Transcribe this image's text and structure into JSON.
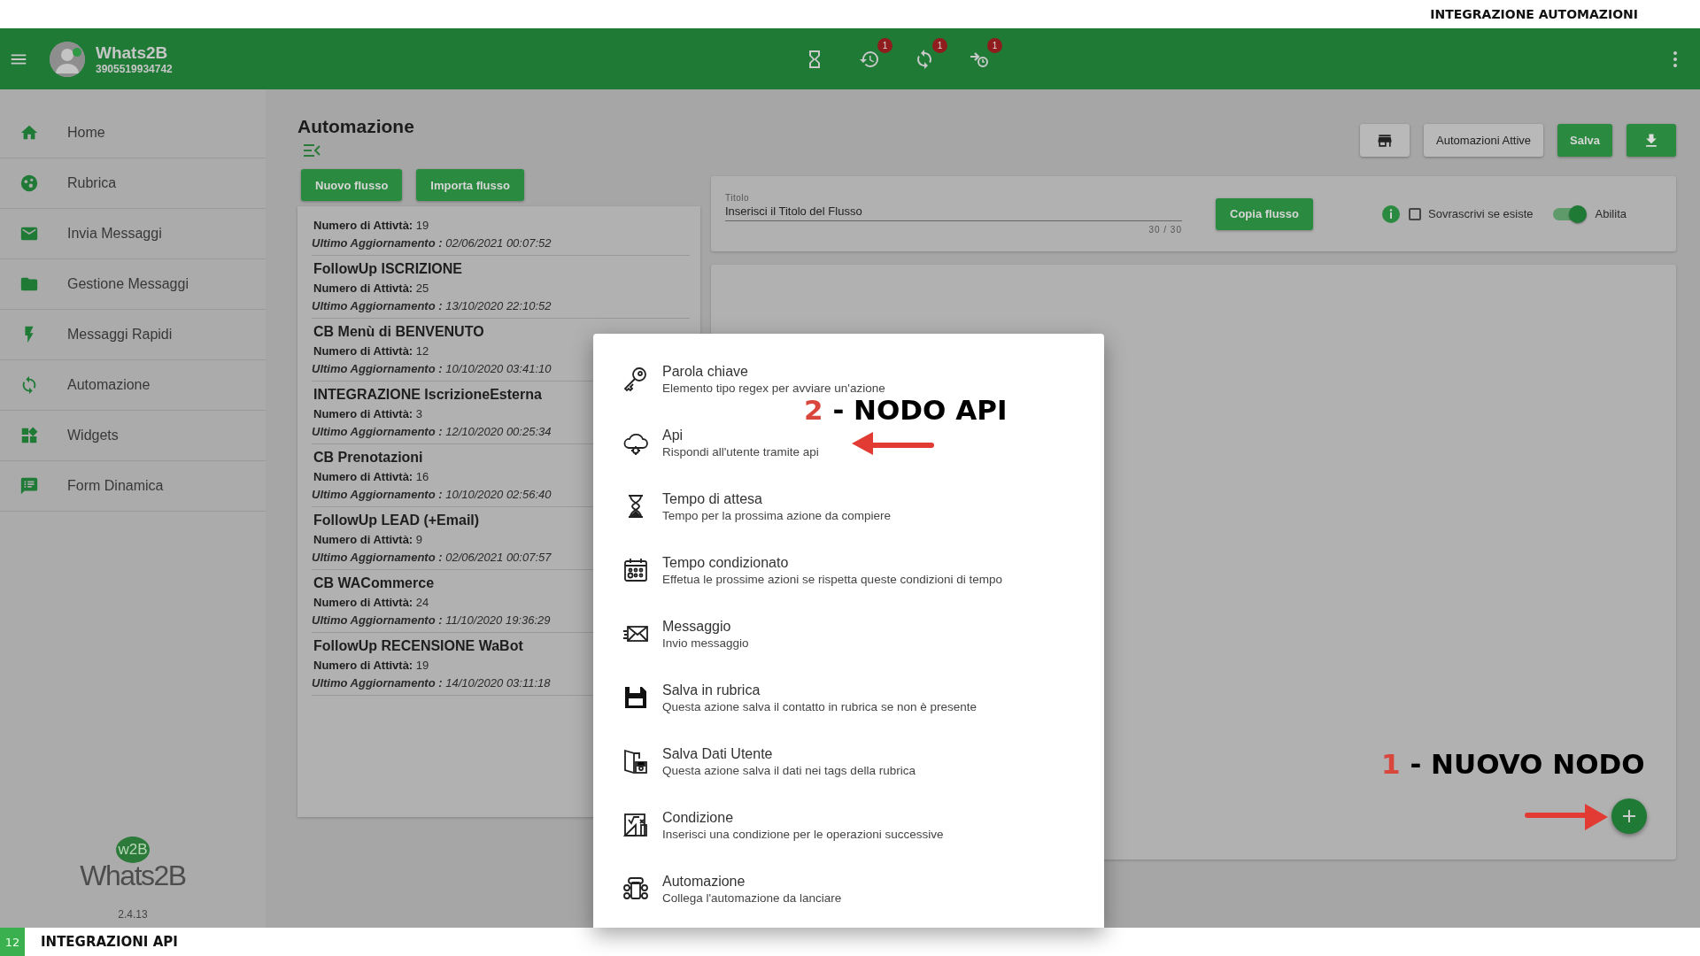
{
  "page_header": "INTEGRAZIONE AUTOMAZIONI",
  "appbar": {
    "name": "Whats2B",
    "phone": "3905519934742",
    "icons": [
      {
        "kind": "hourglass"
      },
      {
        "kind": "history",
        "badge": "1"
      },
      {
        "kind": "sync",
        "badge": "1"
      },
      {
        "kind": "route",
        "badge": "1"
      }
    ]
  },
  "sidebar": {
    "items": [
      {
        "kind": "home",
        "label": "Home"
      },
      {
        "kind": "contacts",
        "label": "Rubrica"
      },
      {
        "kind": "mail",
        "label": "Invia Messaggi"
      },
      {
        "kind": "folder",
        "label": "Gestione Messaggi"
      },
      {
        "kind": "bolt",
        "label": "Messaggi Rapidi"
      },
      {
        "kind": "sync",
        "label": "Automazione"
      },
      {
        "kind": "widgets",
        "label": "Widgets"
      },
      {
        "kind": "form",
        "label": "Form Dinamica"
      }
    ],
    "logo_badge": "w2B",
    "logo_text": "Whats2B",
    "version": "2.4.13"
  },
  "main": {
    "title": "Automazione",
    "buttons": [
      "Nuovo flusso",
      "Importa flusso"
    ],
    "flows": [
      {
        "activities_label": "Numero di Attivtà:",
        "activities": "19",
        "updated_label": "Ultimo Aggiornamento :",
        "updated": "02/06/2021 00:07:52"
      },
      {
        "title": "FollowUp ISCRIZIONE",
        "activities_label": "Numero di Attivtà:",
        "activities": "25",
        "updated_label": "Ultimo Aggiornamento :",
        "updated": "13/10/2020 22:10:52"
      },
      {
        "title": "CB Menù di BENVENUTO",
        "activities_label": "Numero di Attivtà:",
        "activities": "12",
        "updated_label": "Ultimo Aggiornamento :",
        "updated": "10/10/2020 03:41:10"
      },
      {
        "title": "INTEGRAZIONE IscrizioneEsterna",
        "activities_label": "Numero di Attivtà:",
        "activities": "3",
        "updated_label": "Ultimo Aggiornamento :",
        "updated": "12/10/2020 00:25:34"
      },
      {
        "title": "CB Prenotazioni",
        "activities_label": "Numero di Attivtà:",
        "activities": "16",
        "updated_label": "Ultimo Aggiornamento :",
        "updated": "10/10/2020 02:56:40"
      },
      {
        "title": "FollowUp LEAD (+Email)",
        "activities_label": "Numero di Attivtà:",
        "activities": "9",
        "updated_label": "Ultimo Aggiornamento :",
        "updated": "02/06/2021 00:07:57"
      },
      {
        "title": "CB WACommerce",
        "activities_label": "Numero di Attivtà:",
        "activities": "24",
        "updated_label": "Ultimo Aggiornamento :",
        "updated": "11/10/2020 19:36:29"
      },
      {
        "title": "FollowUp RECENSIONE WaBot",
        "activities_label": "Numero di Attivtà:",
        "activities": "19",
        "updated_label": "Ultimo Aggiornamento :",
        "updated": "14/10/2020 03:11:18"
      }
    ]
  },
  "toolbar": [
    {
      "kind": "store"
    },
    {
      "kind": "text",
      "label": "Automazioni Attive"
    },
    {
      "kind": "primary",
      "label": "Salva"
    },
    {
      "kind": "download"
    }
  ],
  "title_form": {
    "label": "Titolo",
    "value": "Inserisci il Titolo del Flusso",
    "counter": "30 / 30",
    "copy_button": "Copia flusso",
    "overwrite": {
      "label": "Sovrascrivi se esiste",
      "checked": false
    },
    "enable": {
      "label": "Abilita",
      "on": true
    }
  },
  "node_menu": {
    "items": [
      {
        "kind": "key",
        "title": "Parola chiave",
        "description": "Elemento tipo regex per avviare un'azione"
      },
      {
        "kind": "api",
        "title": "Api",
        "description": "Rispondi all'utente tramite api"
      },
      {
        "kind": "hourglass",
        "title": "Tempo di attesa",
        "description": "Tempo per la prossima azione da compiere"
      },
      {
        "kind": "calendar",
        "title": "Tempo condizionato",
        "description": "Effetua le prossime azioni se rispetta queste condizioni di tempo"
      },
      {
        "kind": "mail",
        "title": "Messaggio",
        "description": "Invio messaggio"
      },
      {
        "kind": "floppy",
        "title": "Salva in rubrica",
        "description": "Questa azione salva il contatto in rubrica se non è presente"
      },
      {
        "kind": "door",
        "title": "Salva Dati Utente",
        "description": "Questa azione salva il dati nei tags della rubrica"
      },
      {
        "kind": "condition",
        "title": "Condizione",
        "description": "Inserisci una condizione per le operazioni successive"
      },
      {
        "kind": "robot",
        "title": "Automazione",
        "description": "Collega l'automazione da lanciare"
      }
    ]
  },
  "annotations": [
    {
      "number": "2",
      "text": "- NODO API"
    },
    {
      "number": "1",
      "text": "- NUOVO NODO"
    }
  ],
  "footer": {
    "page": "12",
    "title": "INTEGRAZIONI API"
  }
}
